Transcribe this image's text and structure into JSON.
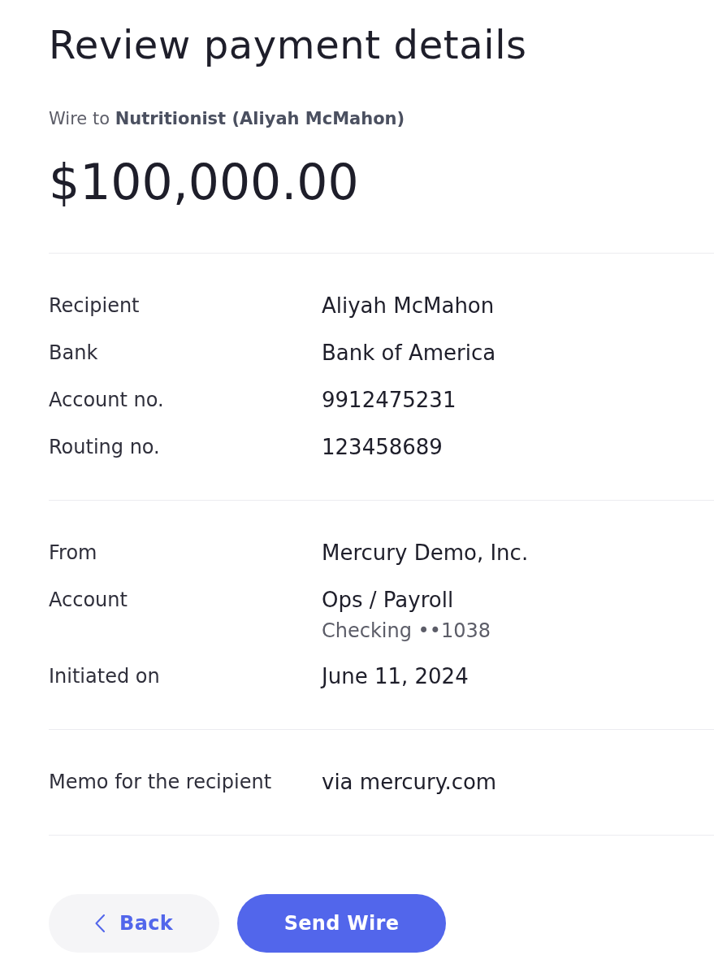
{
  "title": "Review payment details",
  "subtitle": "Wire to **Nutritionist (Aliyah McMahon)**",
  "amount": "$100,000.00",
  "sections": [
    {
      "rows": [
        {
          "label": "Recipient",
          "value": "Aliyah McMahon"
        },
        {
          "label": "Bank",
          "value": "Bank of America"
        },
        {
          "label": "Account no.",
          "value": "9912475231"
        },
        {
          "label": "Routing no.",
          "value": "123458689"
        }
      ]
    },
    {
      "rows": [
        {
          "label": "From",
          "value": "Mercury Demo, Inc."
        },
        {
          "label": "Account",
          "value": "Ops / Payroll",
          "detail": "Checking ••1038"
        },
        {
          "label": "Initiated on",
          "value": "June 11, 2024"
        }
      ]
    },
    {
      "rows": [
        {
          "label": "Memo for the recipient",
          "value": "via mercury.com"
        }
      ]
    }
  ],
  "buttons": [
    {
      "label": "Back",
      "kind": "back"
    },
    {
      "label": "Send Wire",
      "kind": "primary"
    }
  ]
}
